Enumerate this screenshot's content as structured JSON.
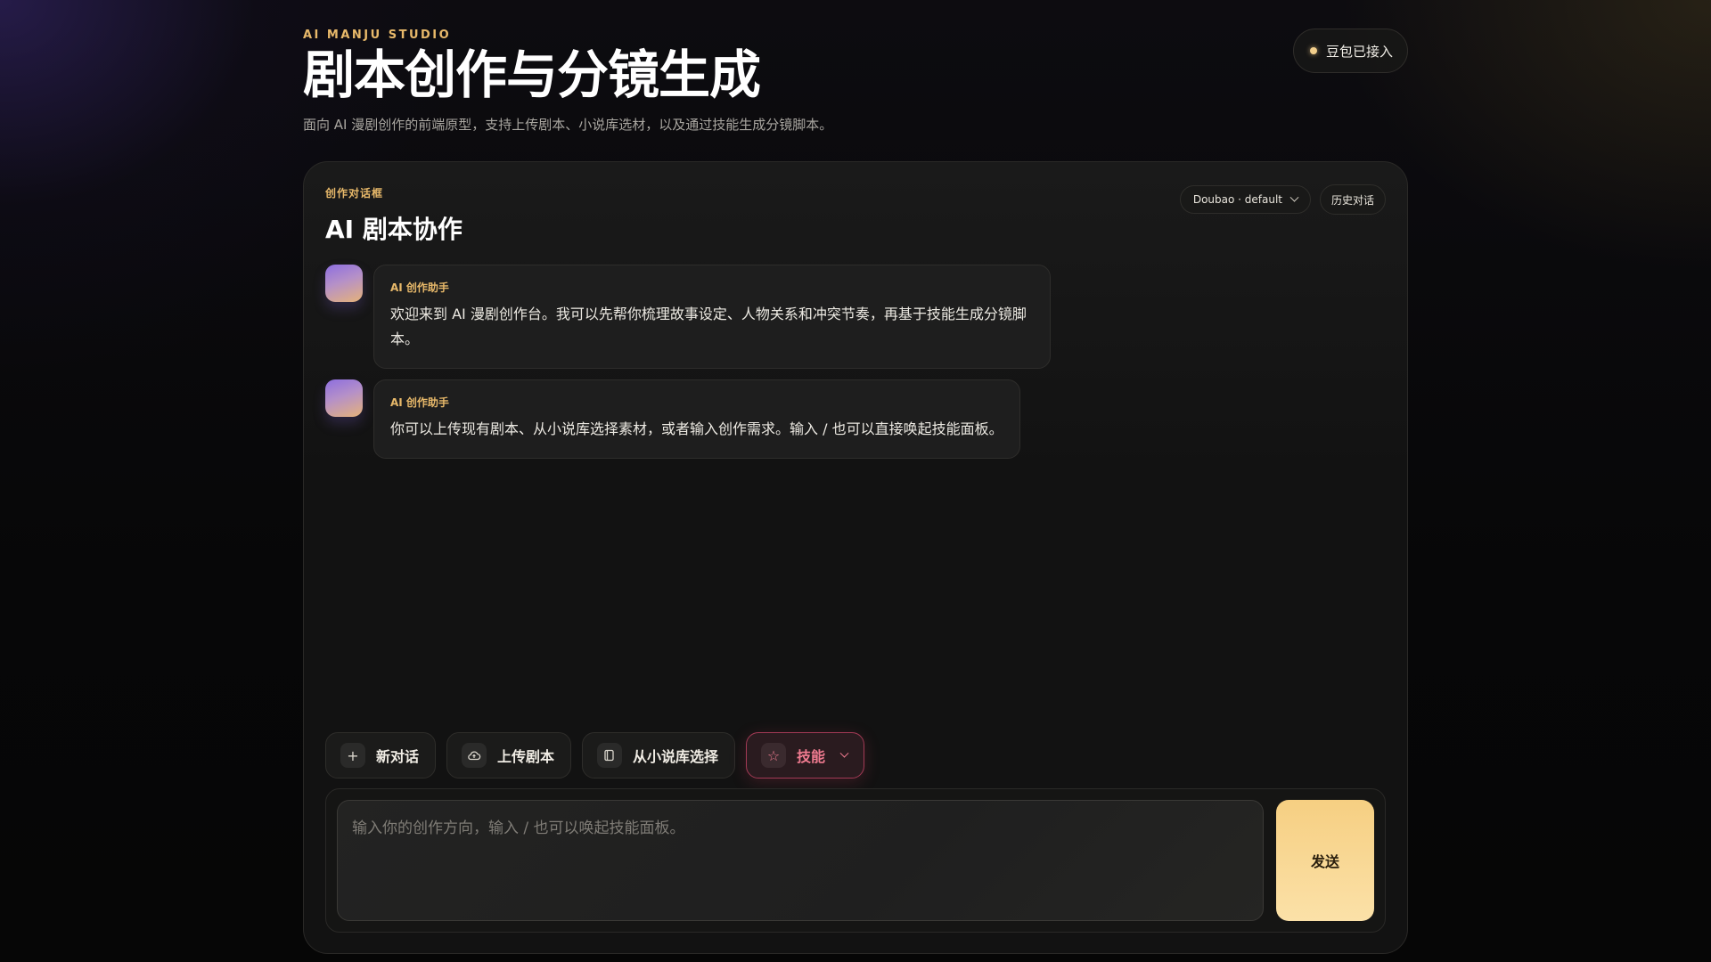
{
  "header": {
    "kicker": "AI MANJU STUDIO",
    "title": "剧本创作与分镜生成",
    "subtitle": "面向 AI 漫剧创作的前端原型，支持上传剧本、小说库选材，以及通过技能生成分镜脚本。",
    "status": "豆包已接入"
  },
  "panel": {
    "kicker": "创作对话框",
    "title": "AI 剧本协作",
    "model_select": "Doubao · default",
    "history_label": "历史对话"
  },
  "messages": [
    {
      "sender": "AI 创作助手",
      "text": "欢迎来到 AI 漫剧创作台。我可以先帮你梳理故事设定、人物关系和冲突节奏，再基于技能生成分镜脚本。"
    },
    {
      "sender": "AI 创作助手",
      "text": "你可以上传现有剧本、从小说库选择素材，或者输入创作需求。输入 / 也可以直接唤起技能面板。"
    }
  ],
  "toolbar": {
    "new_chat": "新对话",
    "upload_script": "上传剧本",
    "from_library": "从小说库选择",
    "skills": "技能"
  },
  "composer": {
    "placeholder": "输入你的创作方向，输入 / 也可以唤起技能面板。",
    "send_label": "发送"
  },
  "colors": {
    "accent": "#e8b96a",
    "skills_accent": "#f07b90",
    "send_button": "#f6cf82"
  },
  "icons": {
    "new_chat": "plus-icon",
    "upload_script": "cloud-upload-icon",
    "from_library": "book-icon",
    "skills": "star-icon"
  }
}
